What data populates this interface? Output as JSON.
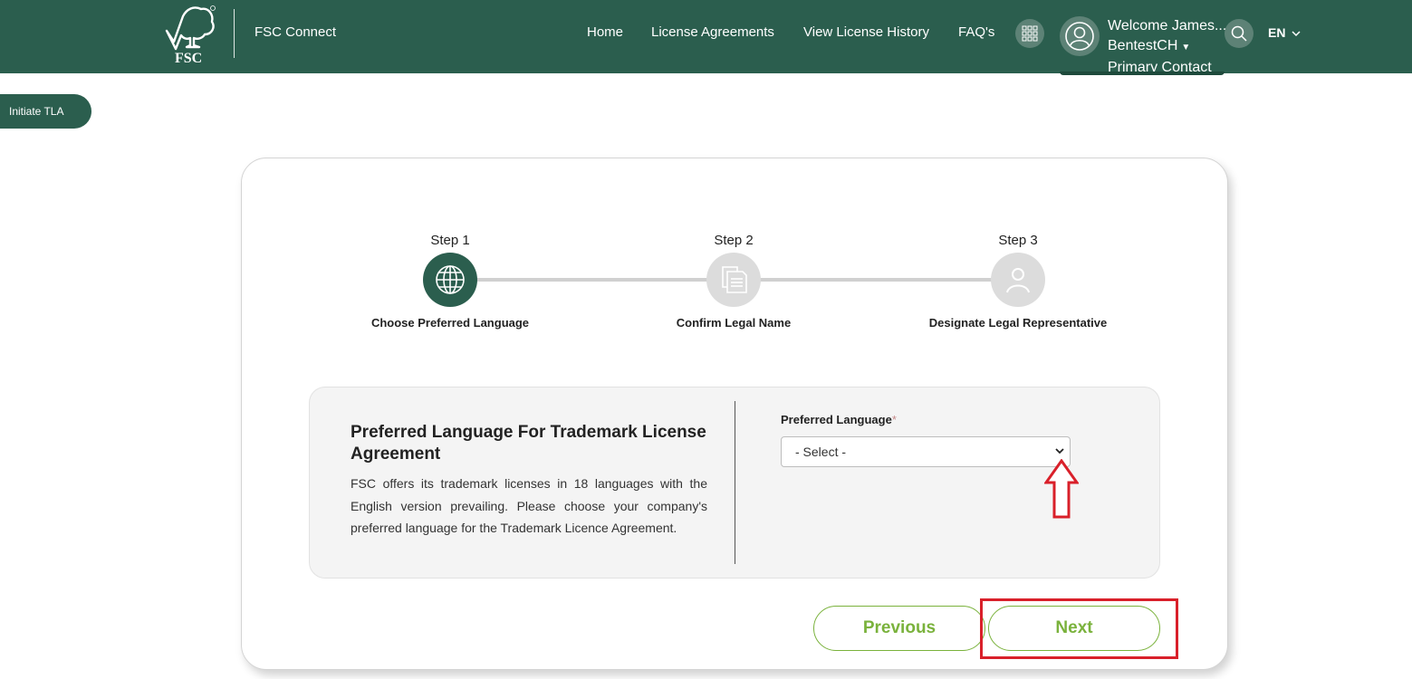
{
  "header": {
    "logo_text": "FSC",
    "app_name": "FSC Connect",
    "nav": {
      "home": "Home",
      "license_agreements": "License Agreements",
      "license_history": "View License History",
      "faq": "FAQ's"
    },
    "user": {
      "welcome": "Welcome James...",
      "account": "BentestCH",
      "role": "Primary Contact"
    },
    "language": "EN"
  },
  "sidebar": {
    "initiate_label": "Initiate TLA"
  },
  "stepper": {
    "steps": [
      {
        "number": "Step 1",
        "label": "Choose Preferred Language",
        "state": "active",
        "icon": "globe-icon"
      },
      {
        "number": "Step 2",
        "label": "Confirm Legal Name",
        "state": "inactive",
        "icon": "document-icon"
      },
      {
        "number": "Step 3",
        "label": "Designate Legal Representative",
        "state": "inactive",
        "icon": "person-icon"
      }
    ]
  },
  "form": {
    "title": "Preferred Language For Trademark License Agreement",
    "description": "FSC offers its trademark licenses in 18 languages with the English version prevailing. Please choose your company's preferred language for the Trademark Licence Agreement.",
    "field_label": "Preferred Language",
    "required_marker": "*",
    "select_value": "- Select -"
  },
  "actions": {
    "previous_label": "Previous",
    "next_label": "Next"
  },
  "colors": {
    "brand_green": "#2b5e4e",
    "button_green": "#7ab23c",
    "annotation_red": "#d9202a"
  }
}
